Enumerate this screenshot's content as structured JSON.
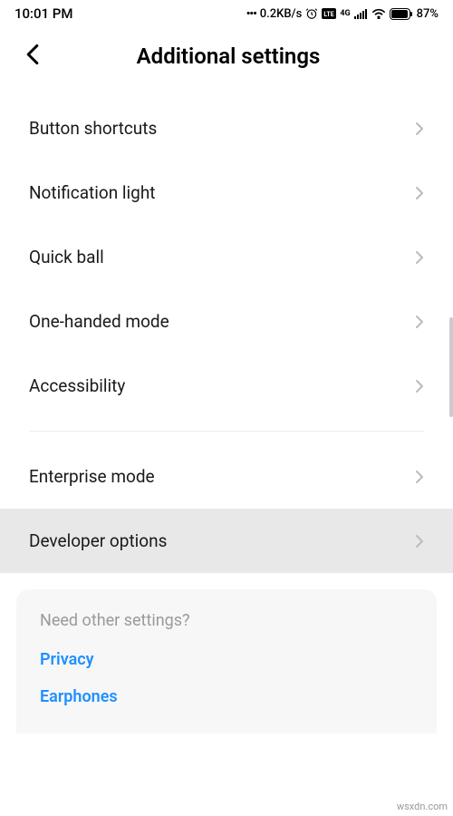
{
  "status": {
    "time": "10:01 PM",
    "speed": "0.2KB/s",
    "battery": "87%"
  },
  "header": {
    "title": "Additional settings"
  },
  "settings": {
    "group1": [
      {
        "label": "Button shortcuts"
      },
      {
        "label": "Notification light"
      },
      {
        "label": "Quick ball"
      },
      {
        "label": "One-handed mode"
      },
      {
        "label": "Accessibility"
      }
    ],
    "group2": [
      {
        "label": "Enterprise mode",
        "highlighted": false
      },
      {
        "label": "Developer options",
        "highlighted": true
      }
    ]
  },
  "footer": {
    "prompt": "Need other settings?",
    "links": [
      {
        "label": "Privacy"
      },
      {
        "label": "Earphones"
      }
    ]
  },
  "watermark": "wsxdn.com"
}
